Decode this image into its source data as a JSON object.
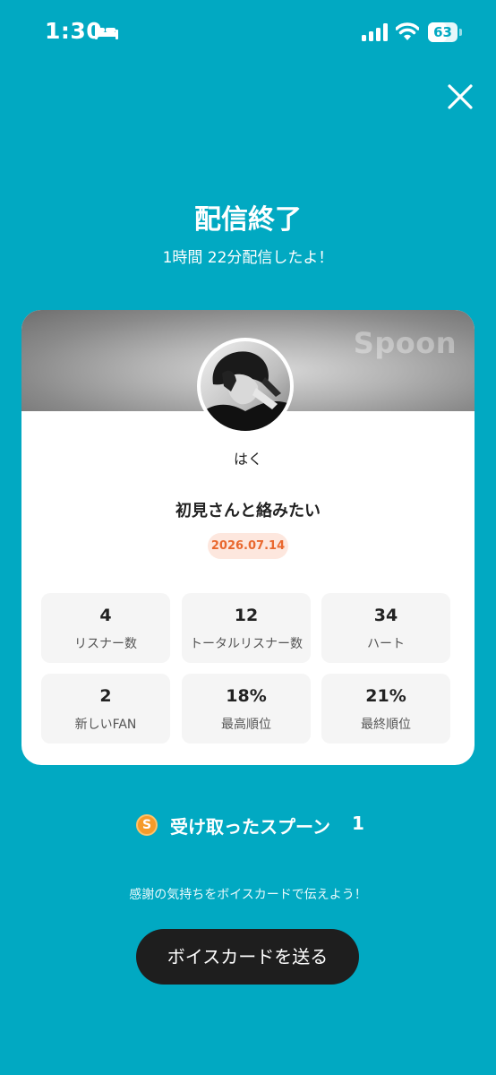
{
  "status_bar": {
    "time": "1:30",
    "battery": "63",
    "battery_level_percent": 63,
    "icons": [
      "bed-icon",
      "cellular-signal-icon",
      "wifi-icon",
      "battery-icon"
    ]
  },
  "header": {
    "close_icon": "close-icon",
    "title": "配信終了",
    "subtitle": "1時間 22分配信したよ！"
  },
  "card": {
    "brand": "Spoon",
    "username": "はく",
    "live_title": "初見さんと絡みたい",
    "date": "2026.07.14",
    "stats": [
      {
        "value": "4",
        "label": "リスナー数"
      },
      {
        "value": "12",
        "label": "トータルリスナー数"
      },
      {
        "value": "34",
        "label": "ハート"
      },
      {
        "value": "2",
        "label": "新しいFAN"
      },
      {
        "value": "18%",
        "label": "最高順位"
      },
      {
        "value": "21%",
        "label": "最終順位"
      }
    ]
  },
  "spoons": {
    "icon_letter": "S",
    "label": "受け取ったスプーン",
    "count": "1"
  },
  "footer": {
    "thanks_text": "感謝の気持ちをボイスカードで伝えよう！",
    "button_label": "ボイスカードを送る"
  },
  "colors": {
    "background": "#01A9C2",
    "date_badge_bg": "#FDE7DE",
    "date_badge_text": "#E9682F",
    "button_bg": "#1E1E1E",
    "spoon_coin": "#F59B2A"
  }
}
